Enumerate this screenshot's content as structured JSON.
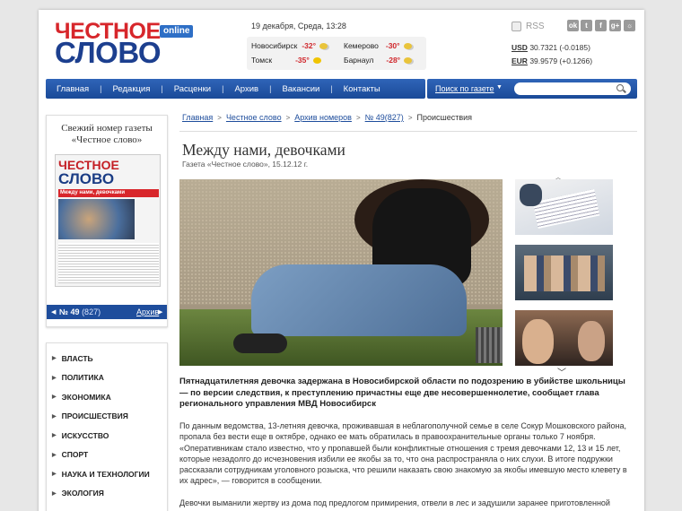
{
  "header": {
    "logo_line1": "ЧЕСТНОЕ",
    "logo_line2": "СЛОВО",
    "logo_badge": "online",
    "date": "19 декабря,  Среда,  13:28",
    "rss": "RSS",
    "social_icons": [
      "odnoklassniki-icon",
      "twitter-icon",
      "facebook-icon",
      "googleplus-icon",
      "vk-icon"
    ],
    "weather": [
      {
        "city": "Новосибирск",
        "temp": "-32°"
      },
      {
        "city": "Кемерово",
        "temp": "-30°"
      },
      {
        "city": "Томск",
        "temp": "-35°"
      },
      {
        "city": "Барнаул",
        "temp": "-28°"
      }
    ],
    "currencies": [
      {
        "code": "USD",
        "value": "30.7321 (-0.0185)"
      },
      {
        "code": "EUR",
        "value": "39.9579 (+0.1266)"
      }
    ]
  },
  "nav": {
    "items": [
      "Главная",
      "Редакция",
      "Расценки",
      "Архив",
      "Вакансии",
      "Контакты"
    ],
    "search_label": "Поиск по газете",
    "search_value": ""
  },
  "sidebar": {
    "issue_caption": "Свежий номер газеты «Честное слово»",
    "issue_number": "№ 49",
    "issue_total": "(827)",
    "archive_link": "Архив",
    "cover": {
      "l1": "ЧЕСТНОЕ",
      "l2": "СЛОВО",
      "headline": "Между нами, девочками"
    },
    "rubrics": [
      "ВЛАСТЬ",
      "ПОЛИТИКА",
      "ЭКОНОМИКА",
      "ПРОИСШЕСТВИЯ",
      "ИСКУССТВО",
      "СПОРТ",
      "НАУКА И ТЕХНОЛОГИИ",
      "ЭКОЛОГИЯ"
    ]
  },
  "breadcrumbs": [
    "Главная",
    "Честное слово",
    "Архив номеров",
    "№ 49(827)",
    "Происшествия"
  ],
  "article": {
    "title": "Между нами, девочками",
    "meta": "Газета  «Честное слово», 15.12.12 г.",
    "lead": "Пятнадцатилетняя девочка задержана в Новосибирской области по подозрению в убийстве школьницы — по версии следствия, к преступлению причастны еще две несовершеннолетие, сообщает глава регионального управления МВД Новосибирск",
    "body": "По данным ведомства, 13-летняя девочка, проживавшая в неблагополучной семье в селе Сокур Мошковского района, пропала без вести еще в октябре, однако ее мать обратилась в правоохранительные органы только 7 ноября. «Оперативникам стало известно, что у пропавшей были конфликтные отношения с тремя девочками 12, 13 и 15 лет, которые незадолго до исчезновения избили ее якобы за то, что она распространяла о них слухи. В итоге подружки рассказали сотрудникам уголовного розыска, что решили наказать свою знакомую за якобы имевшую место клевету в их адрес», — говорится в сообщении.",
    "body2": "Девочки выманили жертву из дома под предлогом примирения, отвели в лес и задушили заранее приготовленной"
  }
}
